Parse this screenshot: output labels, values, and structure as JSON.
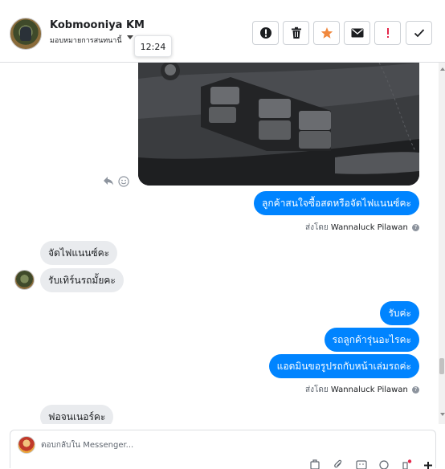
{
  "header": {
    "contact_name": "Kobmooniya KM",
    "assign_label": "มอบหมายการสนทนานี้",
    "tooltip_time": "12:24",
    "actions": [
      {
        "icon": "exclamation-circle-icon",
        "name": "spam-button"
      },
      {
        "icon": "trash-icon",
        "name": "delete-button"
      },
      {
        "icon": "star-icon",
        "name": "star-button",
        "color": "#f0883e"
      },
      {
        "icon": "envelope-icon",
        "name": "mark-unread-button"
      },
      {
        "icon": "exclamation-icon",
        "name": "follow-up-button",
        "color": "#e4264a"
      },
      {
        "icon": "checkmark-icon",
        "name": "mark-done-button"
      }
    ]
  },
  "messages": {
    "out_1": "ลูกค้าสนใจซื้อสดหรือจัดไฟแนนซ์คะ",
    "sent_by_1": {
      "prefix": "ส่งโดย",
      "name": "Wannaluck Pilawan"
    },
    "in_1": "จัดไฟแนนซ์คะ",
    "in_2": "รับเทิร์นรถมั้ยคะ",
    "out_2": "รับค่ะ",
    "out_3": "รถลูกค้ารุ่นอะไรคะ",
    "out_4": "แอดมินขอรูปรถกับหน้าเล่มรถค่ะ",
    "sent_by_2": {
      "prefix": "ส่งโดย",
      "name": "Wannaluck Pilawan"
    },
    "in_3": "ฟอจนเนอร์คะ"
  },
  "composer": {
    "placeholder": "ตอบกลับใน Messenger..."
  },
  "colors": {
    "accent": "#0084ff",
    "incoming_bubble": "#e9ebee",
    "star": "#f0883e",
    "alert": "#e4264a"
  }
}
